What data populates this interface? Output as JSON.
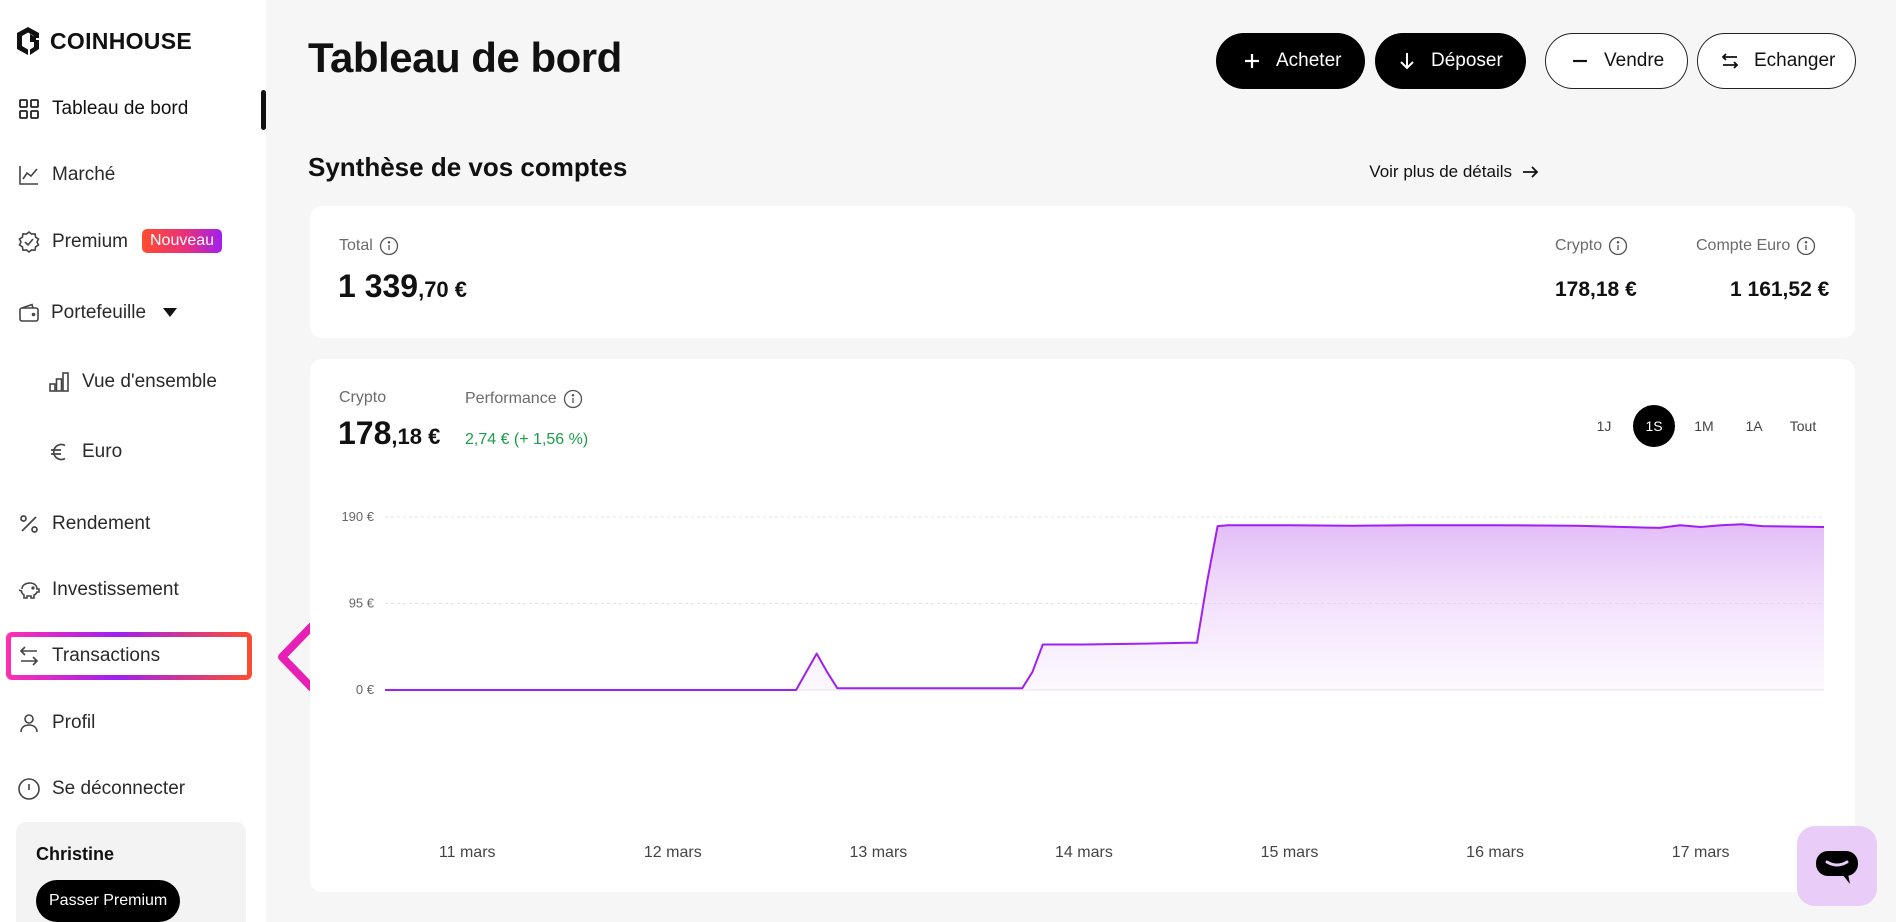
{
  "brand": {
    "name": "COINHOUSE"
  },
  "sidebar": {
    "items": [
      {
        "label": "Tableau de bord",
        "icon": "grid-icon"
      },
      {
        "label": "Marché",
        "icon": "chart-line-icon"
      },
      {
        "label": "Premium",
        "icon": "badge-check-icon",
        "badge": "Nouveau"
      },
      {
        "label": "Portefeuille",
        "icon": "wallet-icon"
      },
      {
        "label": "Vue d'ensemble",
        "icon": "bar-chart-icon"
      },
      {
        "label": "Euro",
        "icon": "euro-icon"
      },
      {
        "label": "Rendement",
        "icon": "percent-icon"
      },
      {
        "label": "Investissement",
        "icon": "piggy-bank-icon"
      },
      {
        "label": "Transactions",
        "icon": "transfer-icon"
      },
      {
        "label": "Profil",
        "icon": "user-icon"
      },
      {
        "label": "Se déconnecter",
        "icon": "power-icon"
      }
    ],
    "user": {
      "name": "Christine",
      "cta": "Passer Premium"
    }
  },
  "header": {
    "title": "Tableau de bord",
    "buttons": {
      "buy": "Acheter",
      "deposit": "Déposer",
      "sell": "Vendre",
      "exchange": "Echanger"
    }
  },
  "summary": {
    "title": "Synthèse de vos comptes",
    "details_link": "Voir plus de détails",
    "total_label": "Total",
    "total_int": "1 339",
    "total_dec": ",70 €",
    "crypto_label": "Crypto",
    "crypto_value": "178,18 €",
    "euro_label": "Compte Euro",
    "euro_value": "1 161,52 €"
  },
  "chart_card": {
    "crypto_label": "Crypto",
    "crypto_int": "178",
    "crypto_dec": ",18 €",
    "performance_label": "Performance",
    "performance_value": "2,74 €  (+ 1,56 %)",
    "ranges": [
      "1J",
      "1S",
      "1M",
      "1A",
      "Tout"
    ],
    "active_range": "1S"
  },
  "colors": {
    "accent": "#a020f0",
    "positive": "#1a9e4b",
    "highlight_pink": "#ff2fb0",
    "highlight_orange": "#ff4d2e"
  },
  "chart_data": {
    "type": "area",
    "x_tick_labels": [
      "11 mars",
      "12 mars",
      "13 mars",
      "14 mars",
      "15 mars",
      "16 mars",
      "17 mars"
    ],
    "y_tick_labels": [
      "0 €",
      "95 €",
      "190 €"
    ],
    "y_ticks": [
      0,
      95,
      190
    ],
    "ylim": [
      0,
      190
    ],
    "xlim": [
      10.6,
      17.6
    ],
    "grid": true,
    "series": [
      {
        "x": [
          10.6,
          11.0,
          12.0,
          12.6,
          12.65,
          12.7,
          12.75,
          12.8,
          13.0,
          13.5,
          13.7,
          13.75,
          13.8,
          14.0,
          14.3,
          14.5,
          14.55,
          14.6,
          14.65,
          14.7,
          15.0,
          15.3,
          15.6,
          16.0,
          16.4,
          16.8,
          16.9,
          17.0,
          17.1,
          17.2,
          17.3,
          17.6
        ],
        "y": [
          0,
          0,
          0,
          0,
          20,
          40,
          20,
          2,
          2,
          2,
          2,
          20,
          50,
          50,
          51,
          52,
          52,
          120,
          180,
          181,
          181,
          180.5,
          181,
          181,
          180.5,
          178,
          181,
          179,
          181,
          182,
          180,
          179
        ]
      }
    ]
  }
}
